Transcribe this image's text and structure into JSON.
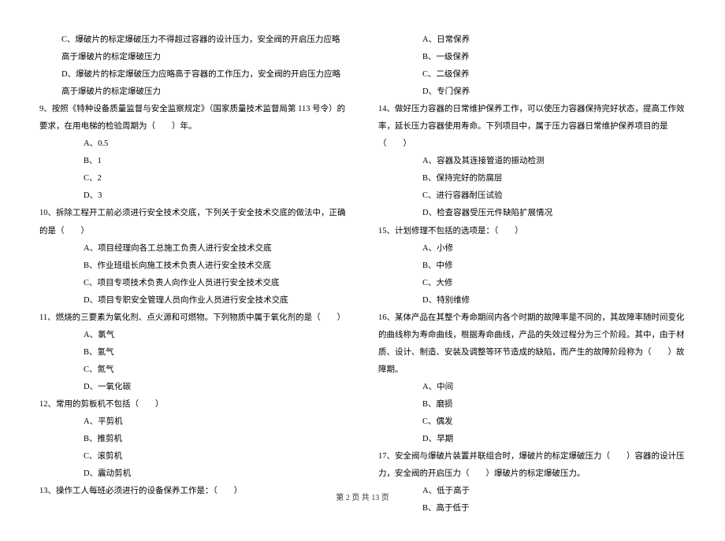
{
  "left": {
    "q8c": "C、爆破片的标定爆破压力不得超过容器的设计压力，安全阀的开启压力应略高于爆破片的标定爆破压力",
    "q8d": "D、爆破片的标定爆破压力应略高于容器的工作压力，安全阀的开启压力应略高于爆破片的标定爆破压力",
    "q9": "9、按照《特种设备质量监督与安全监察规定》（国家质量技术监督局第 113 号令）的要求，在用电梯的检验周期为（　　）年。",
    "q9a": "A、0.5",
    "q9b": "B、1",
    "q9c": "C、2",
    "q9d": "D、3",
    "q10": "10、拆除工程开工前必须进行安全技术交底，下列关于安全技术交底的做法中，正确的是（　　）",
    "q10a": "A、项目经理向各工总施工负责人进行安全技术交底",
    "q10b": "B、作业班组长向施工技术负责人进行安全技术交底",
    "q10c": "C、项目专项技术负责人向作业人员进行安全技术交底",
    "q10d": "D、项目专职安全管理人员向作业人员进行安全技术交底",
    "q11": "11、燃烧的三要素为氧化剂、点火源和可燃物。下列物质中属于氧化剂的是（　　）",
    "q11a": "A、氯气",
    "q11b": "B、氢气",
    "q11c": "C、氮气",
    "q11d": "D、一氧化碳",
    "q12": "12、常用的剪板机不包括（　　）",
    "q12a": "A、平剪机",
    "q12b": "B、推剪机",
    "q12c": "C、滚剪机",
    "q12d": "D、震动剪机",
    "q13": "13、操作工人每班必须进行的设备保养工作是：（　　）"
  },
  "right": {
    "q13a": "A、日常保养",
    "q13b": "B、一级保养",
    "q13c": "C、二级保养",
    "q13d": "D、专门保养",
    "q14": "14、做好压力容器的日常维护保养工作，可以使压力容器保持完好状态，提高工作效率，延长压力容器使用寿命。下列项目中，属于压力容器日常维护保养项目的是（　　）",
    "q14a": "A、容器及其连接管道的振动检测",
    "q14b": "B、保持完好的防腐层",
    "q14c": "C、进行容器耐压试验",
    "q14d": "D、检查容器受压元件缺陷扩展情况",
    "q15": "15、计划修理不包括的选项是：（　　）",
    "q15a": "A、小修",
    "q15b": "B、中修",
    "q15c": "C、大修",
    "q15d": "D、特别维修",
    "q16": "16、某体产品在其整个寿命期间内各个时期的故障率是不同的，其故障率随时间变化的曲线称为寿命曲线，根据寿命曲线，产品的失效过程分为三个阶段。其中，由于材质、设计、制造、安装及调整等环节造成的缺陷，而产生的故障阶段称为（　　）故障期。",
    "q16a": "A、中间",
    "q16b": "B、磨损",
    "q16c": "C、偶发",
    "q16d": "D、早期",
    "q17": "17、安全阀与爆破片装置并联组合时，爆破片的标定爆破压力（　　）容器的设计压力，安全阀的开启压力（　　）爆破片的标定爆破压力。",
    "q17a": "A、低于高于",
    "q17b": "B、高于低于"
  },
  "footer": "第 2 页 共 13 页"
}
